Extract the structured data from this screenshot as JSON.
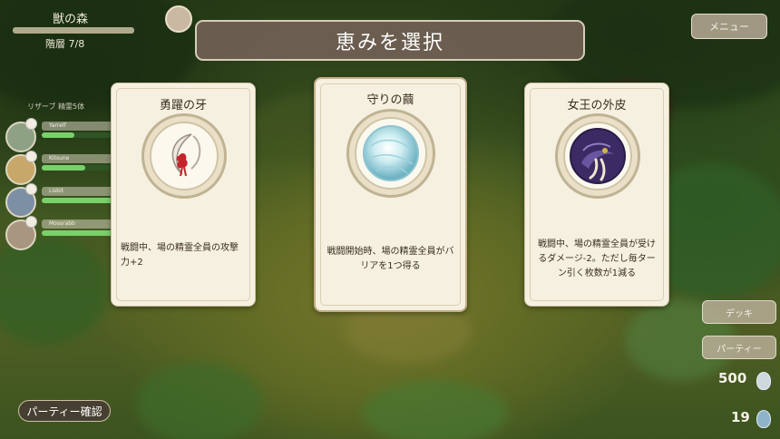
{
  "header": {
    "title": "恵みを選択"
  },
  "status": {
    "floor_name": "獣の森",
    "progress": "階層 7/8"
  },
  "party": {
    "title": "リザーブ 精霊5体",
    "members": [
      {
        "name": "Yarrelf",
        "hp_fraction": 0.45
      },
      {
        "name": "Kitsune",
        "hp_fraction": 0.6
      },
      {
        "name": "Lisbit",
        "hp_fraction": 1.0
      },
      {
        "name": "Mossrabb",
        "hp_fraction": 1.0
      }
    ]
  },
  "cards": [
    {
      "title": "勇躍の牙",
      "emblem": "fang-icon",
      "description": "戦闘中、場の精霊全員の攻撃力+2"
    },
    {
      "title": "守りの繭",
      "emblem": "cocoon-icon",
      "description": "戦闘開始時、場の精霊全員がバリアを1つ得る"
    },
    {
      "title": "女王の外皮",
      "emblem": "queen-shell-icon",
      "description": "戦闘中、場の精霊全員が受けるダメージ-2。ただし毎ターン引く枚数が1減る"
    }
  ],
  "buttons": {
    "menu": "メニュー",
    "deck": "デッキ",
    "party": "パーティー",
    "party_confirm": "パーティー確認"
  },
  "counters": {
    "gold": "500",
    "gems": "19"
  },
  "colors": {
    "card_bg": "#f6f0e0",
    "header_bg": "#706054",
    "hp_green": "#79d16a"
  }
}
